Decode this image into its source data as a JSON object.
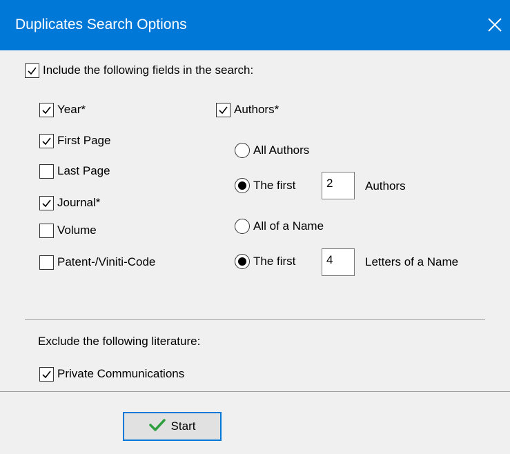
{
  "window": {
    "title": "Duplicates Search Options"
  },
  "include": {
    "label": "Include the following fields in the search:",
    "checked": true,
    "fields": [
      {
        "label": "Year*",
        "checked": true
      },
      {
        "label": "First Page",
        "checked": true
      },
      {
        "label": "Last Page",
        "checked": false
      },
      {
        "label": "Journal*",
        "checked": true
      },
      {
        "label": "Volume",
        "checked": false
      },
      {
        "label": "Patent-/Viniti-Code",
        "checked": false
      }
    ],
    "authors": {
      "label": "Authors*",
      "checked": true,
      "count_mode": {
        "all_label": "All Authors",
        "first_label": "The first",
        "selected": "first",
        "value": "2",
        "suffix": "Authors"
      },
      "name_mode": {
        "all_label": "All of a Name",
        "first_label": "The first",
        "selected": "first",
        "value": "4",
        "suffix": "Letters of a Name"
      }
    }
  },
  "exclude": {
    "label": "Exclude the following literature:",
    "items": [
      {
        "label": "Private Communications",
        "checked": true
      }
    ]
  },
  "buttons": {
    "start": "Start"
  },
  "colors": {
    "titlebar": "#0078d7",
    "dialog_bg": "#f0f0f0",
    "check_icon": "#2e9e3f"
  }
}
